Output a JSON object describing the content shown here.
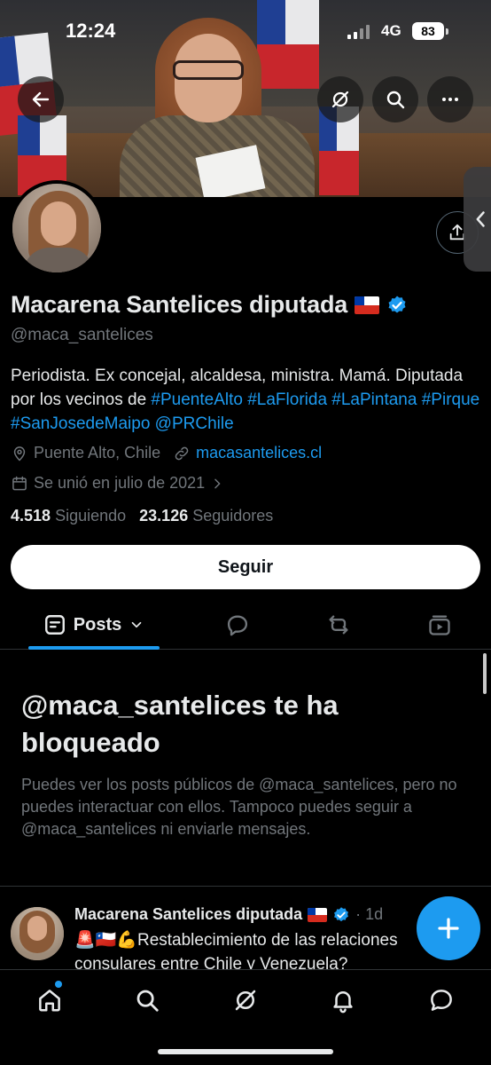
{
  "status": {
    "time": "12:24",
    "network": "4G",
    "battery": "83"
  },
  "profile": {
    "name": "Macarena Santelices diputada",
    "handle": "@maca_santelices",
    "bio_plain_1": "Periodista. Ex concejal, alcaldesa, ministra. Mamá. Diputada por los vecinos de ",
    "bio_tags": [
      "#PuenteAlto",
      "#LaFlorida",
      "#LaPintana",
      "#Pirque",
      "#SanJosedeMaipo",
      "@PRChile"
    ],
    "location": "Puente Alto, Chile",
    "website": "macasantelices.cl",
    "joined": "Se unió en julio de 2021",
    "following_count": "4.518",
    "following_label": "Siguiendo",
    "followers_count": "23.126",
    "followers_label": "Seguidores",
    "follow_label": "Seguir"
  },
  "tabs": {
    "posts_label": "Posts"
  },
  "blocked": {
    "title": "@maca_santelices te ha bloqueado",
    "description": "Puedes ver los posts públicos de @maca_santelices, pero no puedes interactuar con ellos. Tampoco puedes seguir a @maca_santelices ni enviarle mensajes."
  },
  "post": {
    "author": "Macarena Santelices diputada",
    "time": "· 1d",
    "text": "🚨🇨🇱💪Restablecimiento de las relaciones consulares entre Chile y Venezuela?"
  },
  "colors": {
    "accent": "#1d9bf0",
    "muted": "#71767b",
    "text": "#e7e9ea",
    "background": "#000000"
  },
  "icons": [
    "back-arrow-icon",
    "grok-icon",
    "search-icon",
    "more-icon",
    "share-icon",
    "location-icon",
    "link-icon",
    "calendar-icon",
    "chevron-right-icon",
    "posts-icon",
    "chevron-down-icon",
    "reply-icon",
    "repost-icon",
    "media-icon",
    "verified-icon",
    "plus-icon",
    "home-icon",
    "notifications-icon",
    "messages-icon"
  ]
}
